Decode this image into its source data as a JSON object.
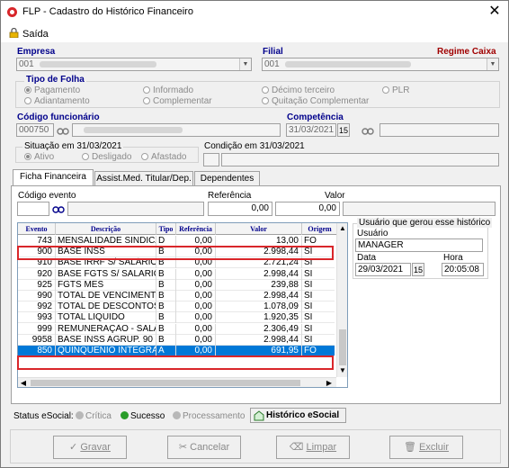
{
  "window": {
    "title": "FLP - Cadastro do Histórico Financeiro"
  },
  "menu": {
    "saida": "Saída"
  },
  "empresa": {
    "label": "Empresa",
    "value": "001"
  },
  "filial": {
    "label": "Filial",
    "value": "001"
  },
  "regime": {
    "label": "Regime Caixa"
  },
  "tipo_folha": {
    "label": "Tipo de Folha",
    "options": [
      "Pagamento",
      "Informado",
      "Décimo terceiro",
      "PLR",
      "Adiantamento",
      "Complementar",
      "Quitação Complementar"
    ],
    "selected": "Pagamento"
  },
  "funcionario": {
    "label": "Código funcionário",
    "value": "000750"
  },
  "competencia": {
    "label": "Competência",
    "value": "31/03/2021"
  },
  "situacao": {
    "label": "Situação em 31/03/2021",
    "options": [
      "Ativo",
      "Desligado",
      "Afastado"
    ],
    "selected": "Ativo"
  },
  "condicao": {
    "label": "Condição em 31/03/2021"
  },
  "tabs": [
    "Ficha Financeira",
    "Assist.Med. Titular/Dep.",
    "Dependentes"
  ],
  "evento_form": {
    "codigo_label": "Código evento",
    "referencia_label": "Referência",
    "referencia_value": "0,00",
    "valor_label": "Valor",
    "valor_value": "0,00"
  },
  "grid": {
    "columns": [
      "Evento",
      "Descrição",
      "Tipo",
      "Referência",
      "Valor",
      "Origem"
    ],
    "rows": [
      [
        "743",
        "MENSALIDADE SINDICAL",
        "D",
        "0,00",
        "13,00",
        "FO"
      ],
      [
        "900",
        "BASE INSS",
        "B",
        "0,00",
        "2.998,44",
        "SI"
      ],
      [
        "910",
        "BASE IRRF S/ SALÁRIOS",
        "B",
        "0,00",
        "2.721,24",
        "SI"
      ],
      [
        "920",
        "BASE FGTS S/ SALARIO",
        "B",
        "0,00",
        "2.998,44",
        "SI"
      ],
      [
        "925",
        "FGTS MES",
        "B",
        "0,00",
        "239,88",
        "SI"
      ],
      [
        "990",
        "TOTAL DE VENCIMENTOS",
        "B",
        "0,00",
        "2.998,44",
        "SI"
      ],
      [
        "992",
        "TOTAL DE DESCONTOS",
        "B",
        "0,00",
        "1.078,09",
        "SI"
      ],
      [
        "993",
        "TOTAL LIQUIDO",
        "B",
        "0,00",
        "1.920,35",
        "SI"
      ],
      [
        "999",
        "REMUNERAÇÃO - SALÁ...",
        "B",
        "0,00",
        "2.306,49",
        "SI"
      ],
      [
        "9958",
        "BASE INSS AGRUP. 90",
        "B",
        "0,00",
        "2.998,44",
        "SI"
      ],
      [
        "850",
        "QUINQUENIO INTEGRAL",
        "A",
        "0,00",
        "691,95",
        "FO"
      ]
    ],
    "selected_row": 10
  },
  "historico": {
    "group_label": "Usuário que gerou esse histórico",
    "usuario_label": "Usuário",
    "usuario_value": "MANAGER",
    "data_label": "Data",
    "data_value": "29/03/2021",
    "hora_label": "Hora",
    "hora_value": "20:05:08"
  },
  "status": {
    "label": "Status eSocial:",
    "critica": "Crítica",
    "sucesso": "Sucesso",
    "processamento": "Processamento",
    "historico_button": "Histórico eSocial"
  },
  "buttons": {
    "gravar": "Gravar",
    "cancelar": "Cancelar",
    "limpar": "Limpar",
    "excluir": "Excluir"
  }
}
